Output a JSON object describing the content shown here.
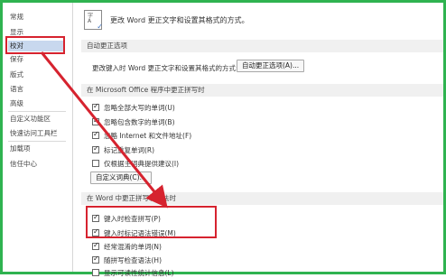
{
  "sidebar": {
    "items": [
      {
        "label": "常规",
        "selected": false
      },
      {
        "label": "显示",
        "selected": false
      },
      {
        "label": "校对",
        "selected": true
      },
      {
        "label": "保存",
        "selected": false
      },
      {
        "label": "版式",
        "selected": false
      },
      {
        "label": "语言",
        "selected": false
      },
      {
        "label": "高级",
        "selected": false
      },
      {
        "label": "自定义功能区",
        "selected": false
      },
      {
        "label": "快速访问工具栏",
        "selected": false
      },
      {
        "label": "加载项",
        "selected": false
      },
      {
        "label": "信任中心",
        "selected": false
      }
    ]
  },
  "header": {
    "icon": "proofing-icon",
    "text": "更改 Word 更正文字和设置其格式的方式。"
  },
  "autocorrect": {
    "section_title": "自动更正选项",
    "line_text": "更改键入时 Word 更正文字和设置其格式的方式:",
    "button_label": "自动更正选项(A)..."
  },
  "office_spelling": {
    "section_title": "在 Microsoft Office 程序中更正拼写时",
    "options": [
      {
        "label": "忽略全部大写的单词(U)",
        "checked": true
      },
      {
        "label": "忽略包含数字的单词(B)",
        "checked": true
      },
      {
        "label": "忽略 Internet 和文件地址(F)",
        "checked": true
      },
      {
        "label": "标记重复单词(R)",
        "checked": true
      },
      {
        "label": "仅根据主词典提供建议(I)",
        "checked": false
      }
    ],
    "dict_button": "自定义词典(C)..."
  },
  "word_spelling": {
    "section_title": "在 Word 中更正拼写和语法时",
    "options": [
      {
        "label": "键入时检查拼写(P)",
        "checked": true
      },
      {
        "label": "键入时标记语法错误(M)",
        "checked": true
      },
      {
        "label": "经常混淆的单词(N)",
        "checked": true
      },
      {
        "label": "随拼写检查语法(H)",
        "checked": true
      },
      {
        "label": "显示可读性统计信息(L)",
        "checked": false
      }
    ]
  },
  "colors": {
    "frame": "#2fb350",
    "highlight": "#d6232f",
    "selected": "#c8d8ee"
  }
}
